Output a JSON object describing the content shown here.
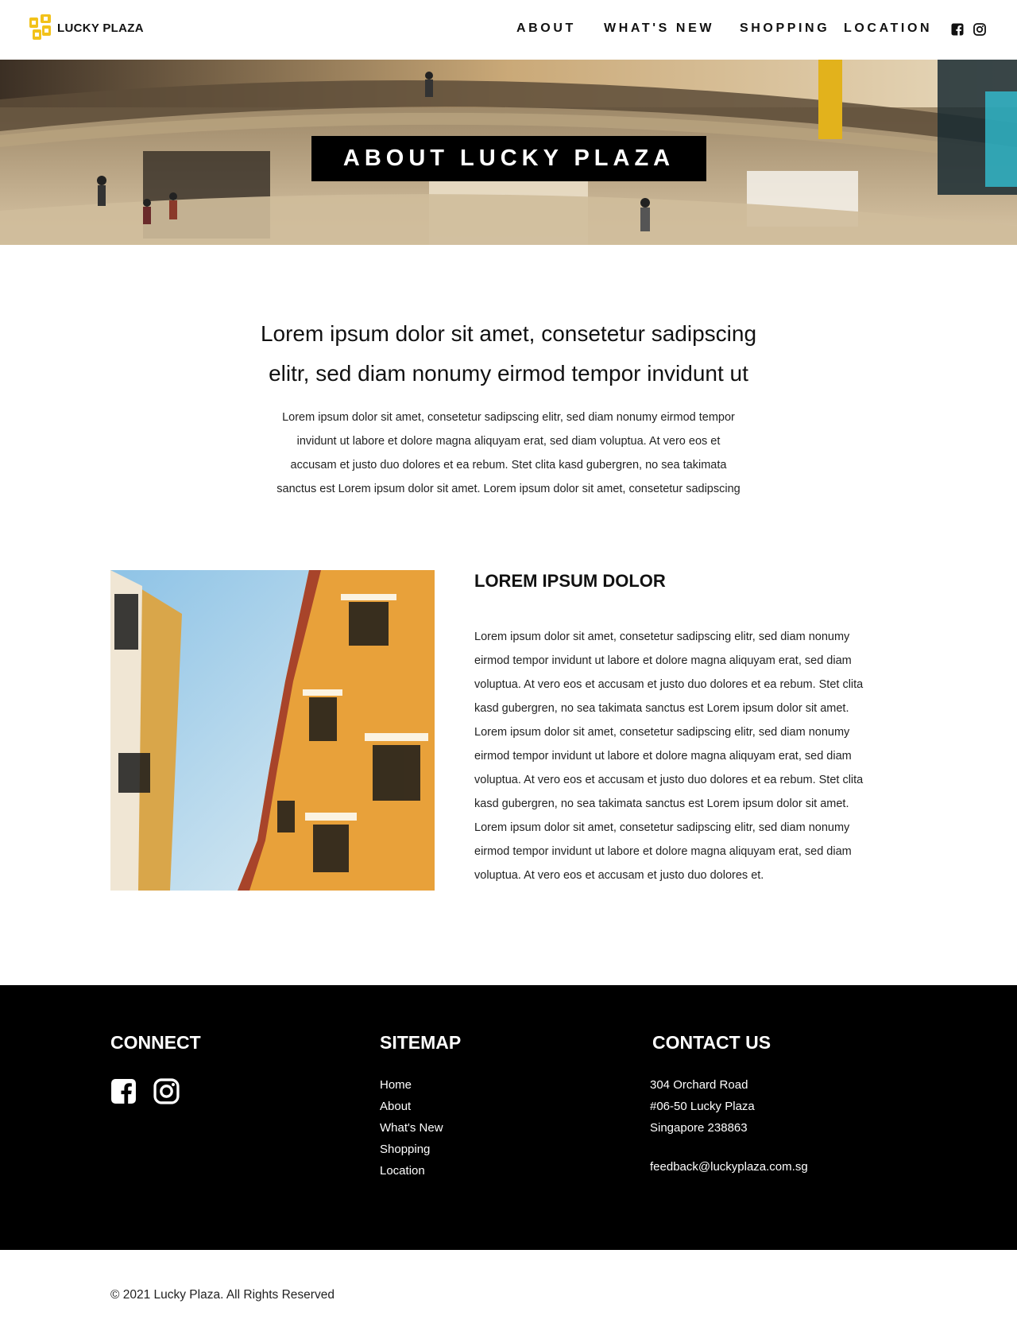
{
  "header": {
    "brand": "LUCKY PLAZA",
    "brand_color": "#f2c21a",
    "nav": [
      {
        "label": "ABOUT"
      },
      {
        "label": "WHAT'S NEW"
      },
      {
        "label": "SHOPPING"
      },
      {
        "label": "LOCATION"
      }
    ],
    "social_icons": [
      "facebook-icon",
      "instagram-icon"
    ]
  },
  "hero": {
    "title": "ABOUT LUCKY PLAZA"
  },
  "intro": {
    "heading_line1": "Lorem ipsum dolor sit amet, consetetur sadipscing",
    "heading_line2": "elitr, sed diam nonumy eirmod tempor invidunt ut",
    "body_lines": [
      "Lorem ipsum dolor sit amet, consetetur sadipscing elitr, sed diam nonumy eirmod tempor",
      "invidunt ut labore et dolore magna aliquyam erat, sed diam voluptua. At vero eos et",
      "accusam et justo duo dolores et ea rebum. Stet clita kasd gubergren, no sea takimata",
      "sanctus est Lorem ipsum dolor sit amet. Lorem ipsum dolor sit amet, consetetur sadipscing"
    ]
  },
  "feature": {
    "title": "LOREM IPSUM DOLOR",
    "body_lines": [
      "Lorem ipsum dolor sit amet, consetetur sadipscing elitr, sed diam nonumy",
      "eirmod tempor invidunt ut labore et dolore magna aliquyam erat, sed diam",
      "voluptua. At vero eos et accusam et justo duo dolores et ea rebum. Stet clita",
      "kasd gubergren, no sea takimata sanctus est Lorem ipsum dolor sit amet.",
      "Lorem ipsum dolor sit amet, consetetur sadipscing elitr, sed diam nonumy",
      "eirmod tempor invidunt ut labore et dolore magna aliquyam erat, sed diam",
      "voluptua. At vero eos et accusam et justo duo dolores et ea rebum. Stet clita",
      "kasd gubergren, no sea takimata sanctus est Lorem ipsum dolor sit amet.",
      "Lorem ipsum dolor sit amet, consetetur sadipscing elitr, sed diam nonumy",
      "eirmod tempor invidunt ut labore et dolore magna aliquyam erat, sed diam",
      "voluptua. At vero eos et accusam et justo duo dolores et."
    ]
  },
  "footer": {
    "connect_title": "CONNECT",
    "sitemap_title": "SITEMAP",
    "contact_title": "CONTACT US",
    "sitemap": [
      "Home",
      "About",
      "What's New",
      "Shopping",
      "Location"
    ],
    "address": [
      "304 Orchard Road",
      "#06-50 Lucky Plaza",
      "Singapore 238863"
    ],
    "email": "feedback@luckyplaza.com.sg",
    "social_icons": [
      "facebook-icon",
      "instagram-icon"
    ]
  },
  "copyright": "© 2021 Lucky Plaza. All Rights Reserved"
}
